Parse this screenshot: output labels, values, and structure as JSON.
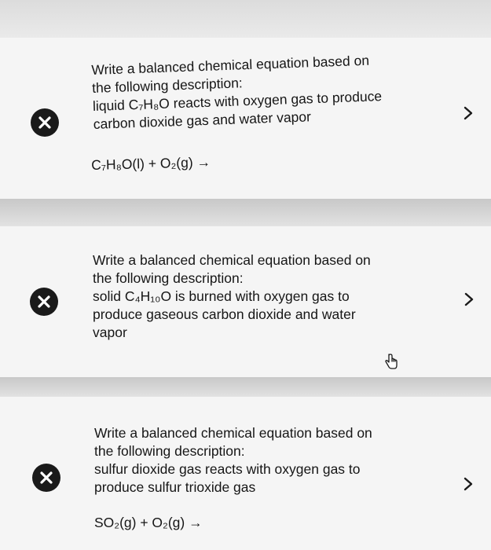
{
  "questions": [
    {
      "lines": [
        "Write a balanced chemical equation based on",
        "the following description:",
        "liquid C₇H₈O reacts with oxygen gas to produce",
        "carbon dioxide gas and water vapor"
      ],
      "equation": "C₇H₈O(l) + O₂(g) →"
    },
    {
      "lines": [
        "Write a balanced chemical equation based on",
        "the following description:",
        "solid C₄H₁₀O is burned with oxygen gas to",
        "produce gaseous carbon dioxide and water",
        "vapor"
      ],
      "equation": ""
    },
    {
      "lines": [
        "Write a balanced chemical equation based on",
        "the following description:",
        "sulfur dioxide gas reacts with oxygen gas to",
        "produce sulfur trioxide gas"
      ],
      "equation": "SO₂(g) + O₂(g) →"
    }
  ],
  "icons": {
    "status": "close-x-icon",
    "expand": "chevron-right-icon",
    "pointer": "hand-cursor-icon"
  },
  "colors": {
    "icon_dark": "#1a1a1a",
    "background": "#f5f5f5",
    "separator": "#cfcfcf"
  }
}
